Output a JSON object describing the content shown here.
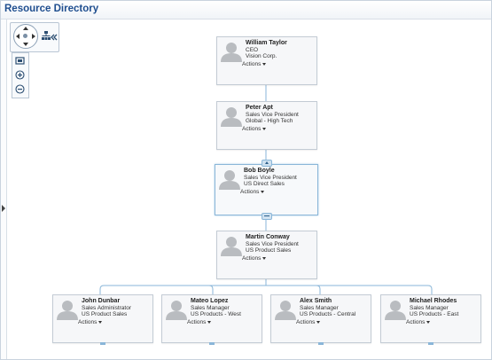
{
  "window": {
    "title": "Resource Directory"
  },
  "controls": {
    "nav": "pan-navigation-control",
    "layout_icon": "hierarchy-layout-icon",
    "panel_toggle": "double-chevron-left-icon",
    "zoom": [
      "fit-to-screen-icon",
      "zoom-in-icon",
      "zoom-out-icon"
    ]
  },
  "people": [
    {
      "name": "William Taylor",
      "title": "CEO",
      "org": "Vision Corp.",
      "actions": "Actions"
    },
    {
      "name": "Peter Apt",
      "title": "Sales Vice President",
      "org": "Global - High Tech",
      "actions": "Actions"
    },
    {
      "name": "Bob Boyle",
      "title": "Sales Vice President",
      "org": "US Direct Sales",
      "actions": "Actions"
    },
    {
      "name": "Martin Conway",
      "title": "Sales Vice President",
      "org": "US Product Sales",
      "actions": "Actions"
    },
    {
      "name": "John Dunbar",
      "title": "Sales Administrator",
      "org": "US Product Sales",
      "actions": "Actions"
    },
    {
      "name": "Mateo Lopez",
      "title": "Sales Manager",
      "org": "US Products - West",
      "actions": "Actions"
    },
    {
      "name": "Alex Smith",
      "title": "Sales Manager",
      "org": "US Products - Central",
      "actions": "Actions"
    },
    {
      "name": "Michael Rhodes",
      "title": "Sales Manager",
      "org": "US Products - East",
      "actions": "Actions"
    }
  ],
  "colors": {
    "title": "#1f4e8f",
    "connector": "#8ab6d8",
    "selected_border": "#8ab6d8",
    "card_bg": "#f6f7f9"
  }
}
